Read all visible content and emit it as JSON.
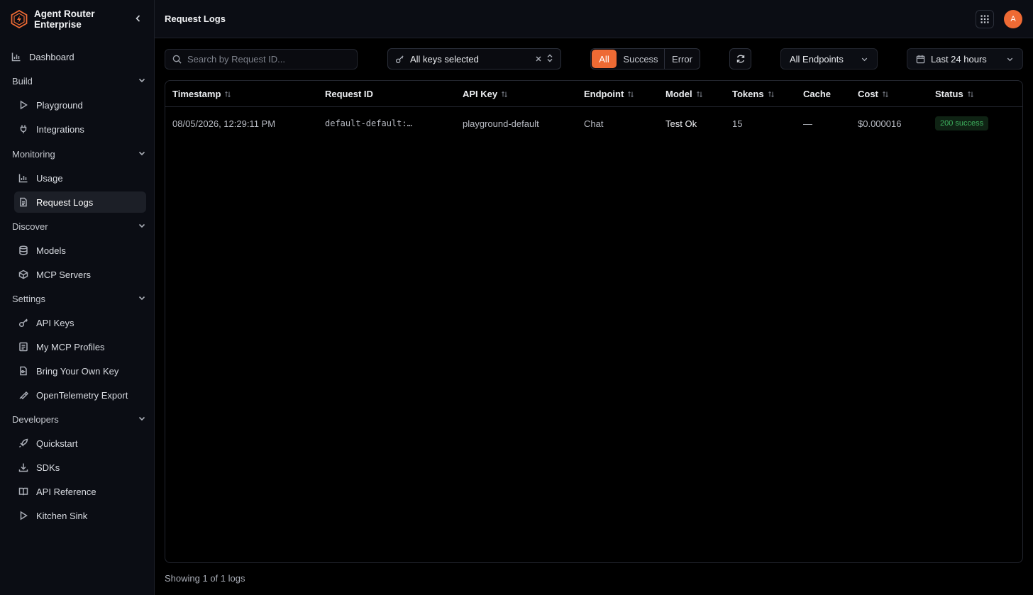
{
  "brand": {
    "title": "Agent Router Enterprise"
  },
  "header": {
    "page_title": "Request Logs",
    "avatar_initial": "A"
  },
  "nav": {
    "dashboard": "Dashboard",
    "build": {
      "label": "Build",
      "items": [
        "Playground",
        "Integrations"
      ]
    },
    "monitoring": {
      "label": "Monitoring",
      "items": [
        "Usage",
        "Request Logs"
      ]
    },
    "discover": {
      "label": "Discover",
      "items": [
        "Models",
        "MCP Servers"
      ]
    },
    "settings": {
      "label": "Settings",
      "items": [
        "API Keys",
        "My MCP Profiles",
        "Bring Your Own Key",
        "OpenTelemetry Export"
      ]
    },
    "developers": {
      "label": "Developers",
      "items": [
        "Quickstart",
        "SDKs",
        "API Reference",
        "Kitchen Sink"
      ]
    },
    "active": "Request Logs"
  },
  "toolbar": {
    "search_placeholder": "Search by Request ID...",
    "keys_label": "All keys selected",
    "status_filter": [
      "All",
      "Success",
      "Error"
    ],
    "status_selected": "All",
    "endpoint_label": "All Endpoints",
    "range_label": "Last 24 hours"
  },
  "table": {
    "columns": [
      "Timestamp",
      "Request ID",
      "API Key",
      "Endpoint",
      "Model",
      "Tokens",
      "Cache",
      "Cost",
      "Status"
    ],
    "rows": [
      {
        "timestamp": "08/05/2026, 12:29:11 PM",
        "request_id": "default-default:…",
        "api_key": "playground-default",
        "endpoint": "Chat",
        "model": "Test Ok",
        "tokens": "15",
        "cache": "—",
        "cost": "$0.000016",
        "status": "200 success"
      }
    ]
  },
  "footer": {
    "summary": "Showing 1 of 1 logs"
  },
  "colors": {
    "accent": "#ee6a34",
    "success": "#3fb35f",
    "background": "#000000",
    "sidebar": "#0b0d14"
  }
}
